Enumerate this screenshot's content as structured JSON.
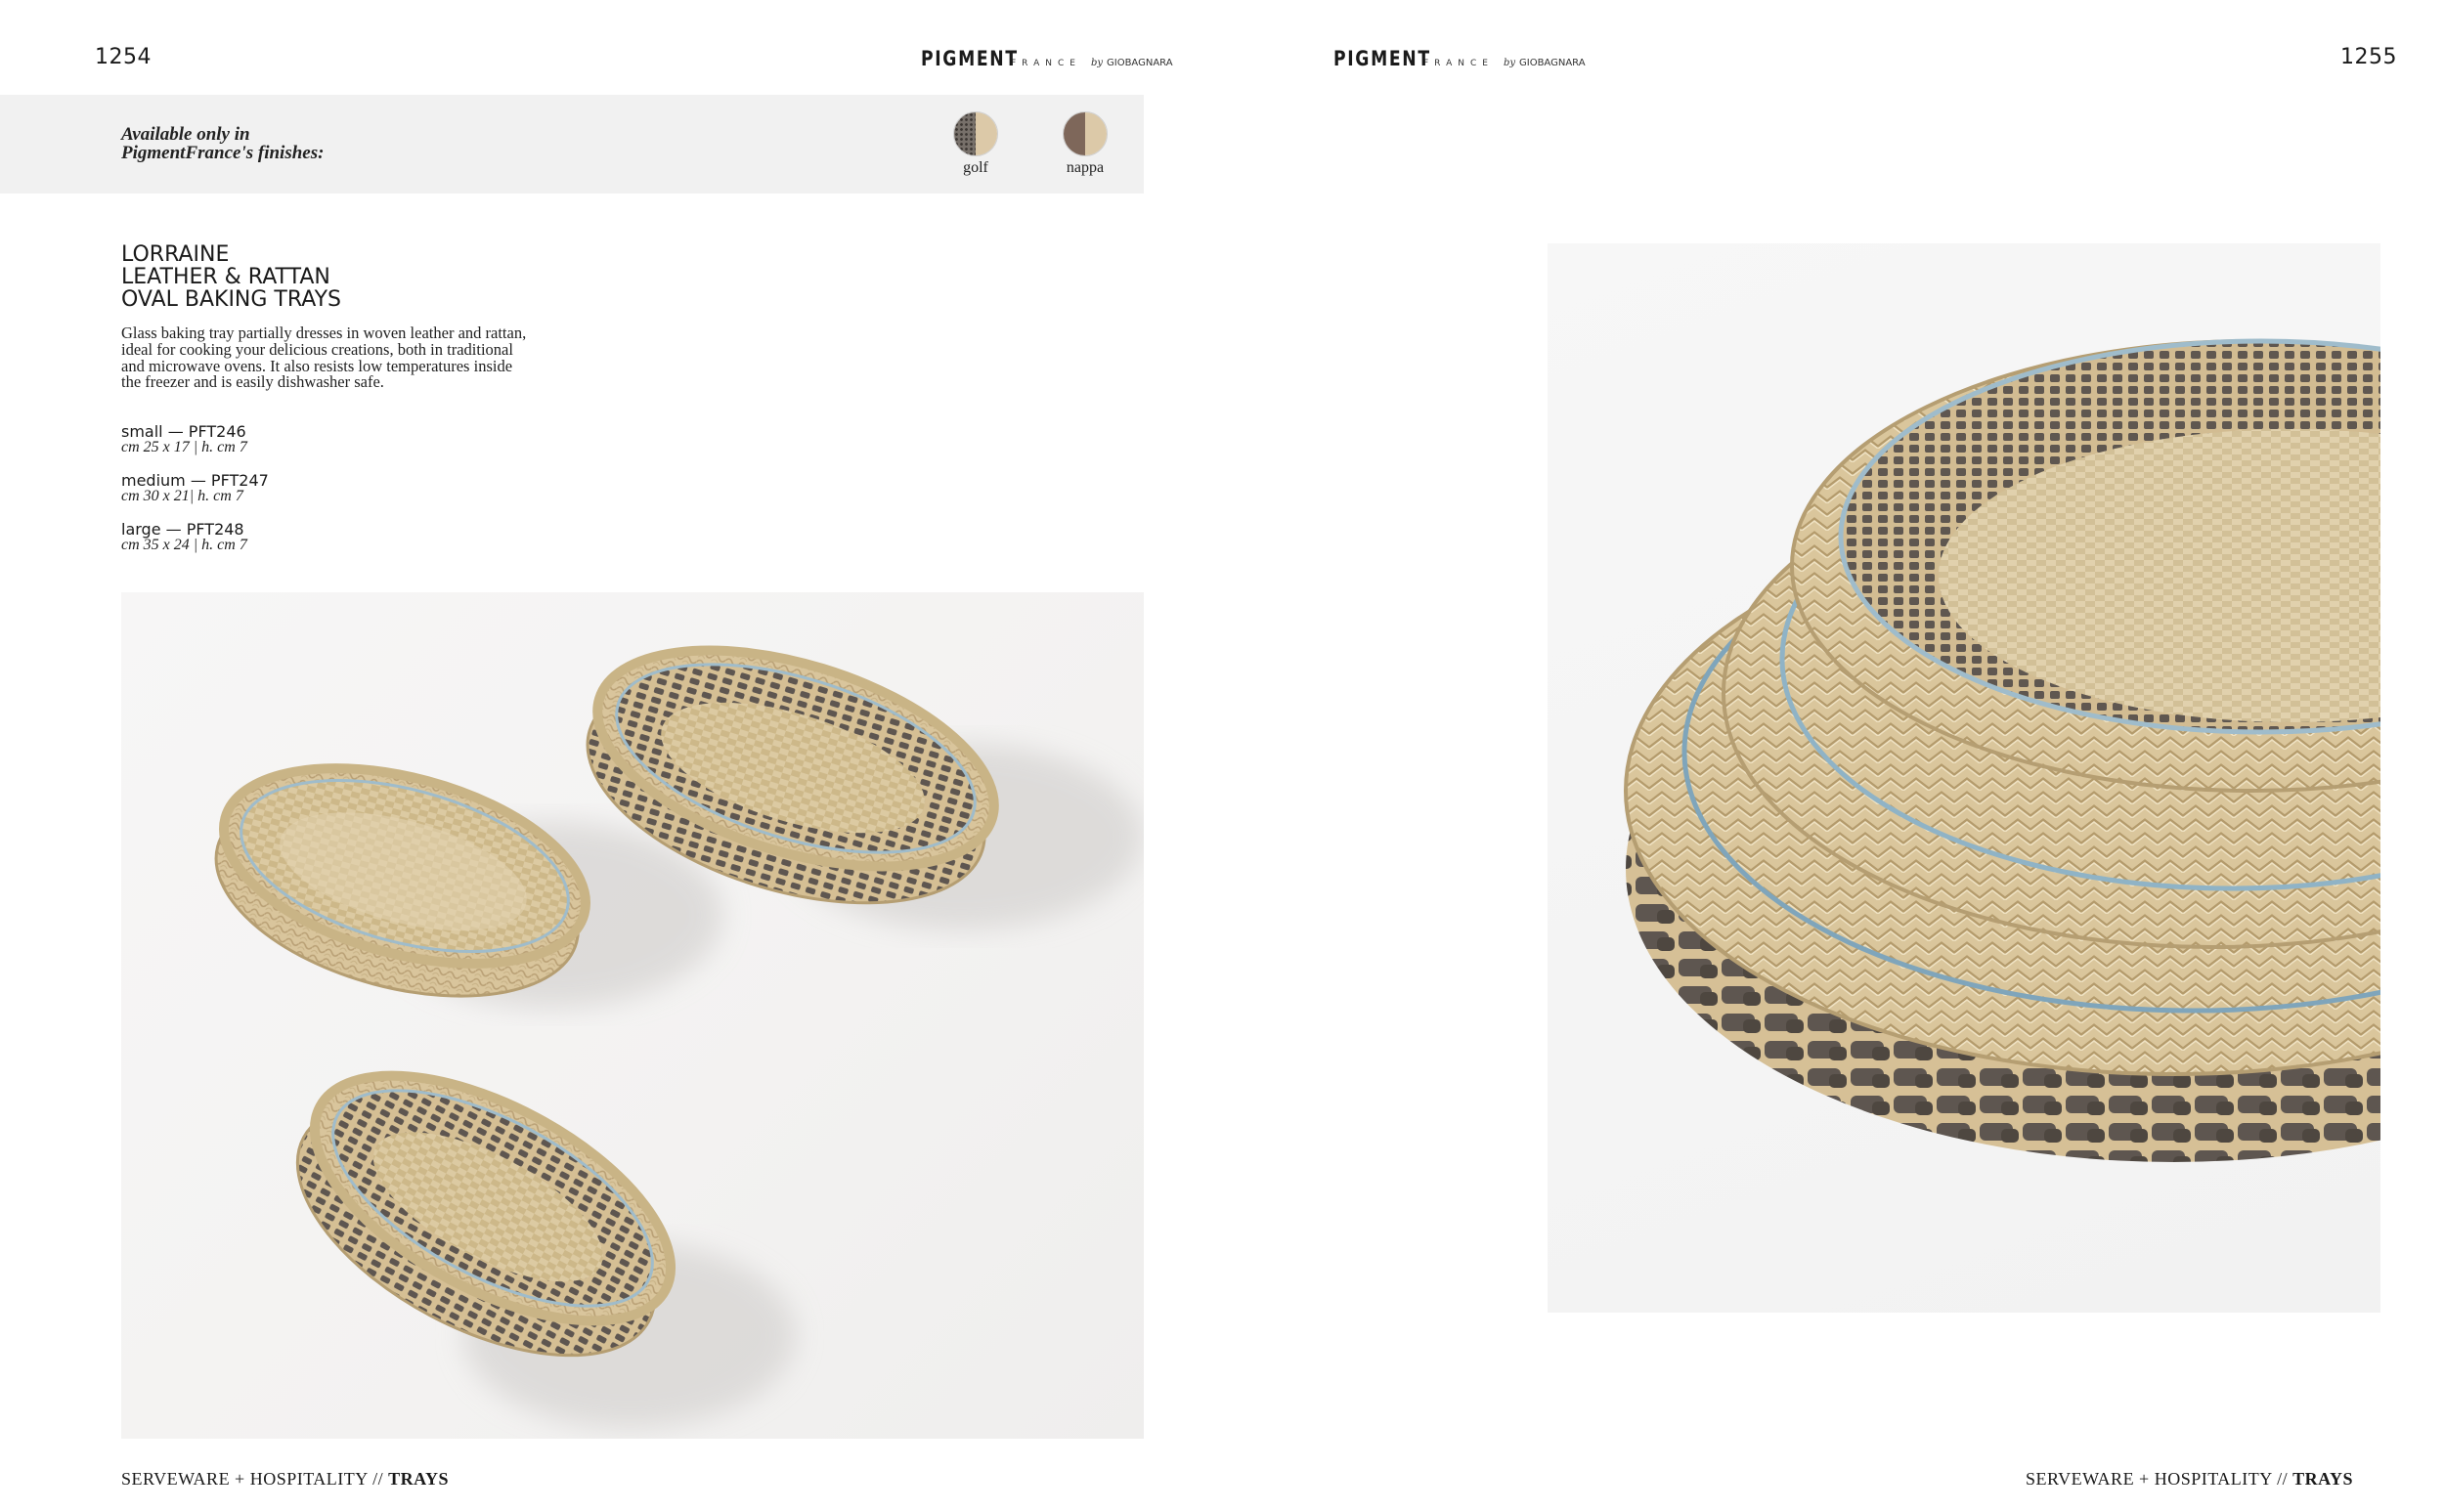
{
  "left_page": {
    "page_number": "1254",
    "brand": {
      "name": "PIGMENT",
      "sub": "FRANCE",
      "by": "by",
      "maker": "GIOBAGNARA"
    },
    "finishes": {
      "label_line1": "Available only in",
      "label_line2": "PigmentFrance's finishes:",
      "items": [
        {
          "name": "golf",
          "icon": "golf-finish-swatch",
          "colors": [
            "#77706a",
            "#dcc9a8"
          ]
        },
        {
          "name": "nappa",
          "icon": "nappa-finish-swatch",
          "colors": [
            "#7e675a",
            "#dcc9a8"
          ]
        }
      ]
    },
    "product": {
      "title_line1": "LORRAINE",
      "title_line2": "LEATHER & RATTAN",
      "title_line3": "OVAL BAKING TRAYS",
      "description": "Glass baking tray partially dresses in woven leather and rattan, ideal for cooking your delicious creations, both in traditional and microwave ovens. It also resists low temperatures inside the freezer and is easily dishwasher safe.",
      "variants": [
        {
          "name": "small — PFT246",
          "dims": "cm 25 x 17 | h. cm 7"
        },
        {
          "name": "medium — PFT247",
          "dims": "cm 30 x 21| h. cm 7"
        },
        {
          "name": "large — PFT248",
          "dims": "cm 35 x 24 | h. cm 7"
        }
      ]
    },
    "footer": {
      "section": "SERVEWARE + HOSPITALITY //",
      "category": "TRAYS"
    }
  },
  "right_page": {
    "page_number": "1255",
    "brand": {
      "name": "PIGMENT",
      "sub": "FRANCE",
      "by": "by",
      "maker": "GIOBAGNARA"
    },
    "footer": {
      "section": "SERVEWARE + HOSPITALITY //",
      "category": "TRAYS"
    }
  },
  "colors": {
    "rattan": "#d8c49b",
    "rattan_dark": "#b59e72",
    "leather": "#5b534b",
    "glass": "#8fb3c6"
  }
}
